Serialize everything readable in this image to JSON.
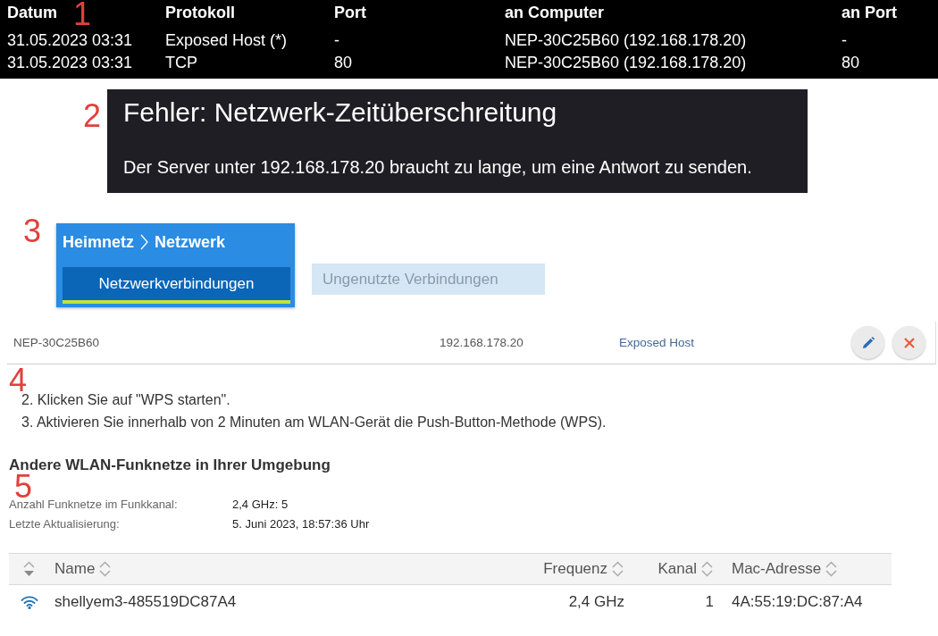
{
  "connections_log": {
    "panel_number": "1",
    "columns": [
      "Datum",
      "Protokoll",
      "Port",
      "an Computer",
      "an Port"
    ],
    "rows": [
      [
        "31.05.2023 03:31",
        "Exposed Host (*)",
        "-",
        "NEP-30C25B60 (192.168.178.20)",
        "-"
      ],
      [
        "31.05.2023 03:31",
        "TCP",
        "80",
        "NEP-30C25B60 (192.168.178.20)",
        "80"
      ]
    ]
  },
  "error_dialog": {
    "panel_number": "2",
    "title": "Fehler: Netzwerk-Zeitüberschreitung",
    "message": "Der Server unter 192.168.178.20 braucht zu lange, um eine Antwort zu senden."
  },
  "network_page": {
    "panel_number": "3",
    "breadcrumb": [
      "Heimnetz",
      "Netzwerk"
    ],
    "tabs": [
      {
        "label": "Netzwerkverbindungen",
        "selected": true
      },
      {
        "label": "Ungenutzte Verbindungen",
        "selected": false
      }
    ]
  },
  "host_entry": {
    "name": "NEP-30C25B60",
    "ip": "192.168.178.20",
    "type": "Exposed Host",
    "actions": [
      {
        "kind": "edit"
      },
      {
        "kind": "delete"
      }
    ]
  },
  "wps_steps": {
    "panel_number": "4",
    "items": [
      "2. Klicken Sie auf \"WPS starten\".",
      "3. Aktivieren Sie innerhalb von 2 Minuten am WLAN-Gerät die Push-Button-Methode (WPS)."
    ]
  },
  "wlan_environment": {
    "title": "Andere WLAN-Funknetze in Ihrer Umgebung",
    "panel_number": "5",
    "details": [
      {
        "label": "Anzahl Funknetze im Funkkanal:",
        "value": "2,4 GHz: 5"
      },
      {
        "label": "Letzte Aktualisierung:",
        "value": "5. Juni 2023, 18:57:36 Uhr"
      }
    ],
    "table": {
      "columns": [
        {
          "label": "Name",
          "kind": "text"
        },
        {
          "label": "Frequenz",
          "kind": "number"
        },
        {
          "label": "Kanal",
          "kind": "number"
        },
        {
          "label": "Mac-Adresse",
          "kind": "text"
        }
      ],
      "rows": [
        {
          "cells": [
            "shellyem3-485519DC87A4",
            "2,4 GHz",
            "1",
            "4A:55:19:DC:87:A4"
          ]
        }
      ]
    }
  }
}
